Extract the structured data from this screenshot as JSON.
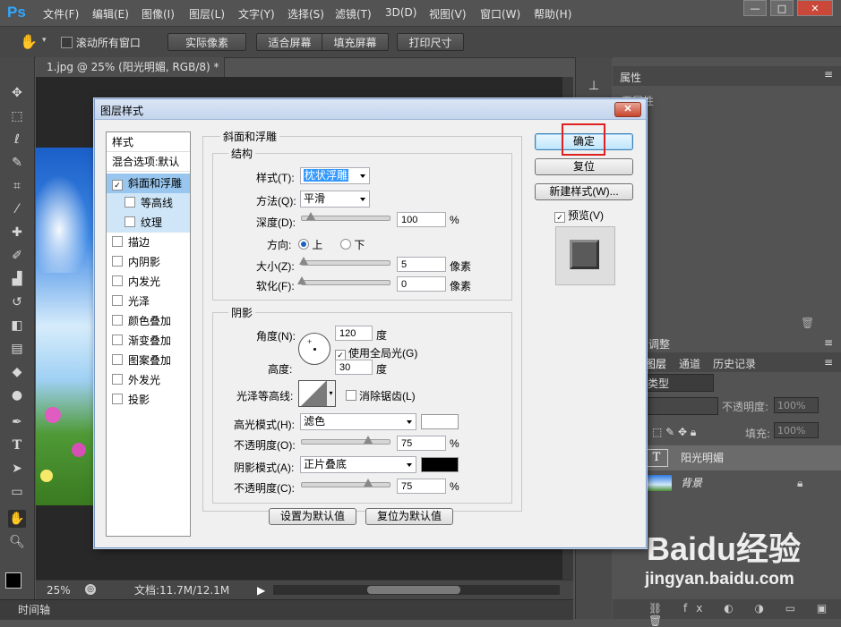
{
  "app": {
    "logo": "Ps"
  },
  "menu": [
    "文件(F)",
    "编辑(E)",
    "图像(I)",
    "图层(L)",
    "文字(Y)",
    "选择(S)",
    "滤镜(T)",
    "3D(D)",
    "视图(V)",
    "窗口(W)",
    "帮助(H)"
  ],
  "window_controls": {
    "minimize": "—",
    "restore": "□",
    "close": "✕"
  },
  "options_bar": {
    "scroll_all": "滚动所有窗口",
    "buttons": [
      "实际像素",
      "适合屏幕",
      "填充屏幕",
      "打印尺寸"
    ]
  },
  "document": {
    "tab_title": "1.jpg @ 25% (阳光明媚, RGB/8) *",
    "tab_close": "×",
    "zoom": "25%",
    "doc_size": "文档:11.7M/12.1M",
    "timeline": "时间轴"
  },
  "panels": {
    "properties_tab": "属性",
    "properties_text": "无属性",
    "adjust_tab": "调整",
    "layers_tabs": [
      "图层",
      "通道",
      "历史记录"
    ],
    "kind_label": "类型",
    "opacity_label": "不透明度:",
    "opacity_value": "100%",
    "fill_label": "填充:",
    "fill_value": "100%",
    "layers": [
      {
        "name": "阳光明媚",
        "type_glyph": "T"
      },
      {
        "name": "背景"
      }
    ]
  },
  "dialog": {
    "title": "图层样式",
    "close_glyph": "✕",
    "styles_header": "样式",
    "blend_options": "混合选项:默认",
    "style_items": [
      {
        "label": "斜面和浮雕",
        "checked": true
      },
      {
        "label": "等高线",
        "checked": false
      },
      {
        "label": "纹理",
        "checked": false
      },
      {
        "label": "描边",
        "checked": false
      },
      {
        "label": "内阴影",
        "checked": false
      },
      {
        "label": "内发光",
        "checked": false
      },
      {
        "label": "光泽",
        "checked": false
      },
      {
        "label": "颜色叠加",
        "checked": false
      },
      {
        "label": "渐变叠加",
        "checked": false
      },
      {
        "label": "图案叠加",
        "checked": false
      },
      {
        "label": "外发光",
        "checked": false
      },
      {
        "label": "投影",
        "checked": false
      }
    ],
    "section_title": "斜面和浮雕",
    "structure": {
      "title": "结构",
      "style_label": "样式(T):",
      "style_value": "枕状浮雕",
      "technique_label": "方法(Q):",
      "technique_value": "平滑",
      "depth_label": "深度(D):",
      "depth_value": "100",
      "depth_unit": "%",
      "depth_fraction": 0.1,
      "direction_label": "方向:",
      "direction_up": "上",
      "direction_down": "下",
      "size_label": "大小(Z):",
      "size_value": "5",
      "size_unit": "像素",
      "size_fraction": 0.02,
      "soften_label": "软化(F):",
      "soften_value": "0",
      "soften_unit": "像素",
      "soften_fraction": 0.0
    },
    "shading": {
      "title": "阴影",
      "angle_label": "角度(N):",
      "angle_value": "120",
      "angle_unit": "度",
      "global_light_label": "使用全局光(G)",
      "altitude_label": "高度:",
      "altitude_value": "30",
      "altitude_unit": "度",
      "gloss_contour_label": "光泽等高线:",
      "antialias_label": "消除锯齿(L)",
      "highlight_mode_label": "高光模式(H):",
      "highlight_mode_value": "滤色",
      "highlight_color": "#ffffff",
      "highlight_opacity_label": "不透明度(O):",
      "highlight_opacity_value": "75",
      "highlight_opacity_fraction": 0.75,
      "shadow_mode_label": "阴影模式(A):",
      "shadow_mode_value": "正片叠底",
      "shadow_color": "#000000",
      "shadow_opacity_label": "不透明度(C):",
      "shadow_opacity_value": "75",
      "shadow_opacity_fraction": 0.75,
      "percent": "%"
    },
    "make_default": "设置为默认值",
    "reset_default": "复位为默认值",
    "ok": "确定",
    "reset": "复位",
    "new_style": "新建样式(W)...",
    "preview_label": "预览(V)"
  },
  "watermark": {
    "brand": "Baidu经验",
    "url": "jingyan.baidu.com"
  },
  "colors": {
    "highlight_box": "#e02020",
    "accent": "#31a8ff"
  }
}
